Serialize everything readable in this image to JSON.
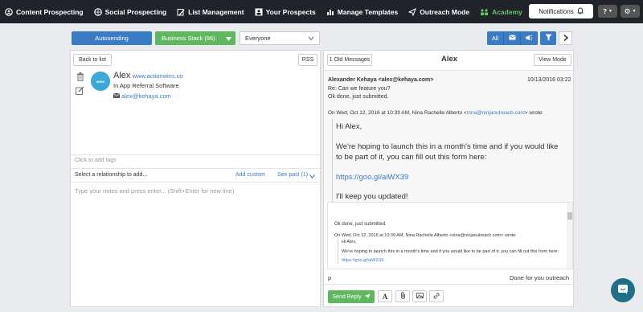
{
  "nav": {
    "items": [
      {
        "label": "Content Prospecting",
        "icon": "search-person-icon"
      },
      {
        "label": "Social Prospecting",
        "icon": "globe-icon"
      },
      {
        "label": "List Management",
        "icon": "pencil-list-icon"
      },
      {
        "label": "Your Prospects",
        "icon": "people-icon"
      },
      {
        "label": "Manage Templates",
        "icon": "chart-icon"
      },
      {
        "label": "Outreach Mode",
        "icon": "send-icon"
      },
      {
        "label": "Academy",
        "icon": "group-icon"
      }
    ],
    "notifications_label": "Notifications",
    "help_label": "?"
  },
  "toolbar": {
    "autosend_label": "Autosending",
    "stack_label": "Business Stack (96)",
    "audience_value": "Everyone",
    "filter_all_label": "All"
  },
  "prospect": {
    "back_label": "Back to list",
    "rss_label": "RSS",
    "avatar_text": "WINS",
    "name": "Alex",
    "website": "www.actionwins.co",
    "company": "In App Referral Software",
    "email": "alex@kehaya.com",
    "tags_placeholder": "Click to add tags",
    "relationship_placeholder": "Select a relationship to add...",
    "add_custom_label": "Add custom",
    "see_past_label": "See past (1)",
    "notes_placeholder": "Type your notes and press enter... (Shift+Enter for new line)"
  },
  "thread": {
    "old_messages_label": "1 Old Messages",
    "title": "Alex",
    "view_mode_label": "View Mode",
    "from": "Alexander Kehaya <alex@kehaya.com>",
    "date": "10/13/2016 03:22",
    "subject": "Re: Can we feature you?",
    "reply_body": "Ok done, just submitted.",
    "quote_header_pre": "On Wed, Oct 12, 2016 at 10:39 AM, Nina Rachelle Alberto <",
    "quote_email": "nina@ninjaoutreach.com",
    "quote_header_post": "> wrote:",
    "quote_greeting": "Hi Alex,",
    "quote_para": "We're hoping to launch this in a month's time and if you would like to be part of it, you can fill out this form here:",
    "quote_link": "https://goo.gl/aiWX39",
    "quote_closing": "I'll keep you updated!"
  },
  "reply": {
    "line1": "Ok done, just submitted.",
    "quote_header": "On Wed, Oct 12, 2016 at 10:39 AM, Nina Rachelle Alberto <nina@ninjaoutreach.com> wrote:",
    "greeting": "Hi Alex,",
    "para": "We're hoping to launch this in a month's time and if you would like to be part of it, you can fill out this form here:",
    "link": "https://goo.gl/aiWX39",
    "status_left": "p",
    "status_right": "Done for you outreach",
    "send_label": "Send Reply"
  }
}
